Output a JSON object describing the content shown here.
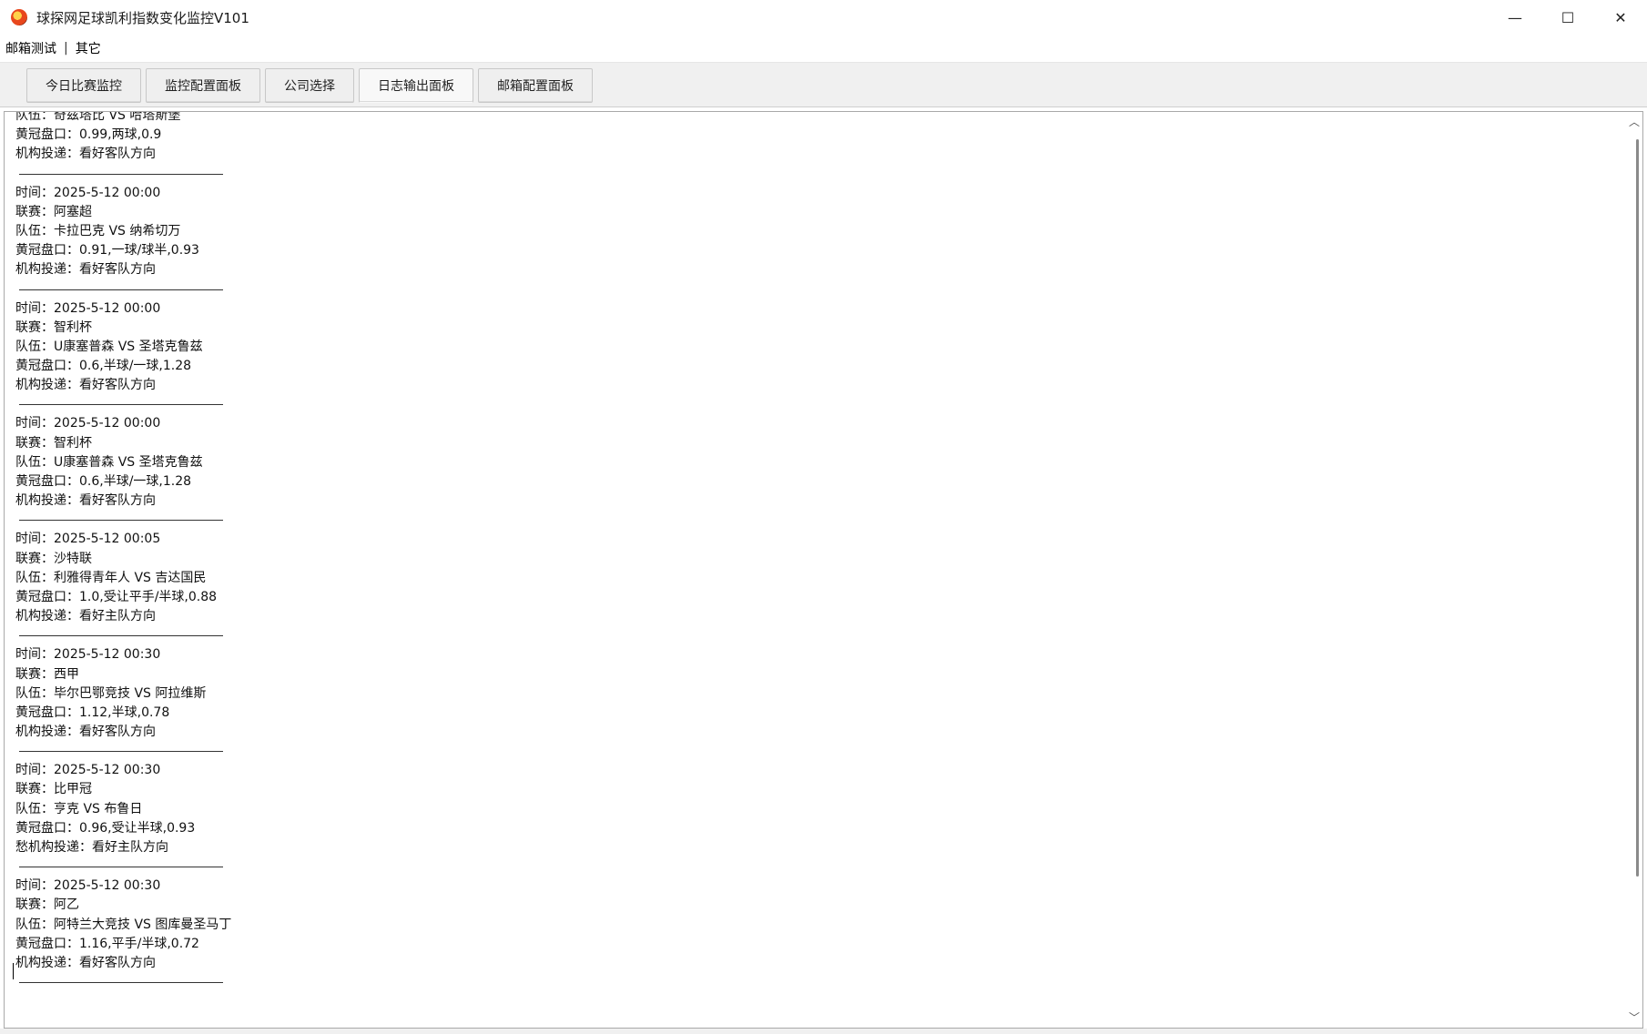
{
  "window": {
    "title": "球探网足球凯利指数变化监控V101",
    "controls": {
      "minimize": "—",
      "maximize": "☐",
      "close": "✕"
    }
  },
  "menu": {
    "items": [
      "邮箱测试",
      "其它"
    ],
    "separator": "|"
  },
  "tabs": [
    {
      "label": "今日比赛监控",
      "active": false
    },
    {
      "label": "监控配置面板",
      "active": false
    },
    {
      "label": "公司选择",
      "active": false
    },
    {
      "label": "日志输出面板",
      "active": true
    },
    {
      "label": "邮箱配置面板",
      "active": false
    }
  ],
  "log": {
    "partial_top": [
      "队伍：奇兹塔比 VS 哈塔斯堡",
      "黄冠盘口：0.99,两球,0.9",
      "机构投递：看好客队方向"
    ],
    "entries": [
      [
        "时间：2025-5-12 00:00",
        "联赛：阿塞超",
        "队伍：卡拉巴克 VS 纳希切万",
        "黄冠盘口：0.91,一球/球半,0.93",
        "机构投递：看好客队方向"
      ],
      [
        "时间：2025-5-12 00:00",
        "联赛：智利杯",
        "队伍：U康塞普森 VS 圣塔克鲁兹",
        "黄冠盘口：0.6,半球/一球,1.28",
        "机构投递：看好客队方向"
      ],
      [
        "时间：2025-5-12 00:00",
        "联赛：智利杯",
        "队伍：U康塞普森 VS 圣塔克鲁兹",
        "黄冠盘口：0.6,半球/一球,1.28",
        "机构投递：看好客队方向"
      ],
      [
        "时间：2025-5-12 00:05",
        "联赛：沙特联",
        "队伍：利雅得青年人 VS 吉达国民",
        "黄冠盘口：1.0,受让平手/半球,0.88",
        "机构投递：看好主队方向"
      ],
      [
        "时间：2025-5-12 00:30",
        "联赛：西甲",
        "队伍：毕尔巴鄂竞技 VS 阿拉维斯",
        "黄冠盘口：1.12,半球,0.78",
        "机构投递：看好客队方向"
      ],
      [
        "时间：2025-5-12 00:30",
        "联赛：比甲冠",
        "队伍：亨克 VS 布鲁日",
        "黄冠盘口：0.96,受让半球,0.93",
        "愁机构投递：看好主队方向"
      ],
      [
        "时间：2025-5-12 00:30",
        "联赛：阿乙",
        "队伍：阿特兰大竞技 VS 图库曼圣马丁",
        "黄冠盘口：1.16,平手/半球,0.72",
        "机构投递：看好客队方向"
      ]
    ]
  },
  "scrollbar": {
    "up": "︿",
    "down": "﹀"
  }
}
